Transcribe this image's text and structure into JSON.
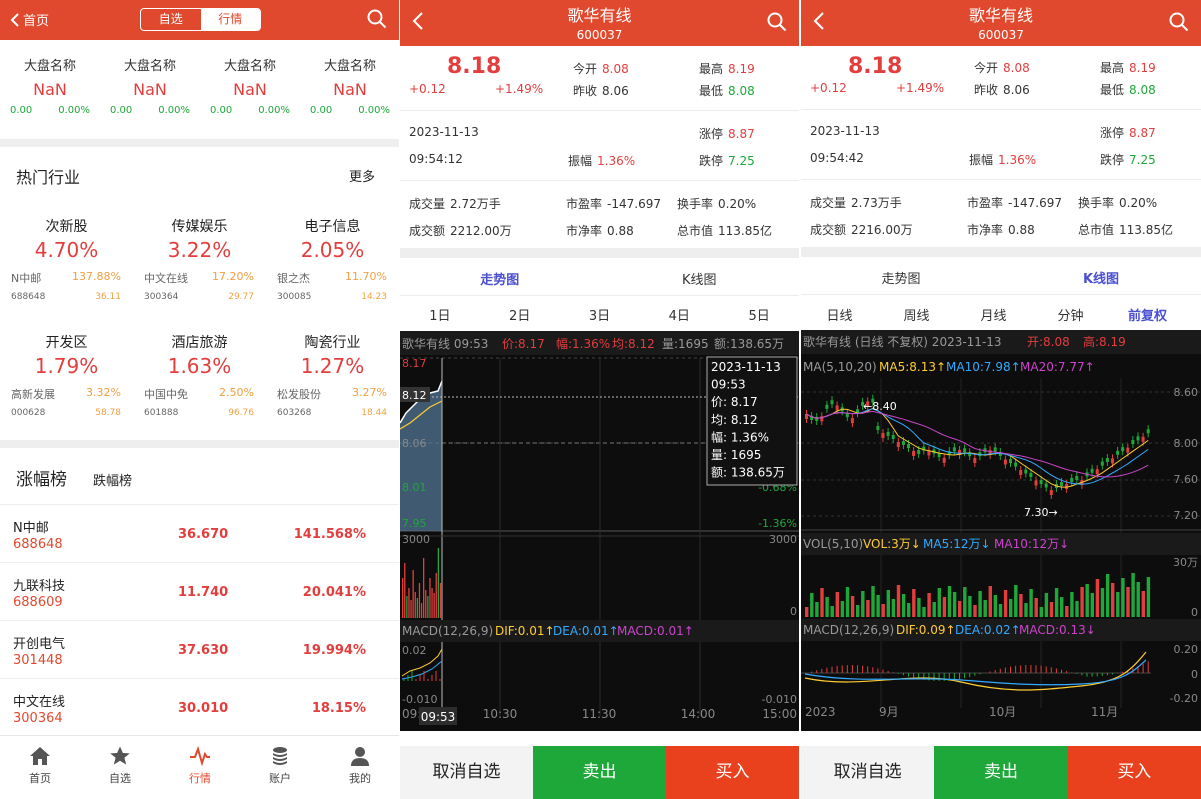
{
  "p1": {
    "header": {
      "back": "首页",
      "seg": [
        "自选",
        "行情"
      ]
    },
    "indices": [
      {
        "name": "大盘名称",
        "value": "NaN",
        "chg": "0.00",
        "pct": "0.00%"
      },
      {
        "name": "大盘名称",
        "value": "NaN",
        "chg": "0.00",
        "pct": "0.00%"
      },
      {
        "name": "大盘名称",
        "value": "NaN",
        "chg": "0.00",
        "pct": "0.00%"
      },
      {
        "name": "大盘名称",
        "value": "NaN",
        "chg": "0.00",
        "pct": "0.00%"
      }
    ],
    "hot": {
      "title": "热门行业",
      "more": "更多"
    },
    "industries": [
      {
        "name": "次新股",
        "pct": "4.70%",
        "stock": "N中邮",
        "spct": "137.88%",
        "code": "688648",
        "price": "36.11"
      },
      {
        "name": "传媒娱乐",
        "pct": "3.22%",
        "stock": "中文在线",
        "spct": "17.20%",
        "code": "300364",
        "price": "29.77"
      },
      {
        "name": "电子信息",
        "pct": "2.05%",
        "stock": "银之杰",
        "spct": "11.70%",
        "code": "300085",
        "price": "14.23"
      },
      {
        "name": "开发区",
        "pct": "1.79%",
        "stock": "高新发展",
        "spct": "3.32%",
        "code": "000628",
        "price": "58.78"
      },
      {
        "name": "酒店旅游",
        "pct": "1.63%",
        "stock": "中国中免",
        "spct": "2.50%",
        "code": "601888",
        "price": "96.76"
      },
      {
        "name": "陶瓷行业",
        "pct": "1.27%",
        "stock": "松发股份",
        "spct": "3.27%",
        "code": "603268",
        "price": "18.44"
      }
    ],
    "rank_tabs": [
      "涨幅榜",
      "跌幅榜"
    ],
    "gainers": [
      {
        "name": "N中邮",
        "code": "688648",
        "price": "36.670",
        "pct": "141.568%"
      },
      {
        "name": "九联科技",
        "code": "688609",
        "price": "11.740",
        "pct": "20.041%"
      },
      {
        "name": "开创电气",
        "code": "301448",
        "price": "37.630",
        "pct": "19.994%"
      },
      {
        "name": "中文在线",
        "code": "300364",
        "price": "30.010",
        "pct": "18.15%"
      }
    ],
    "tabbar": [
      "首页",
      "自选",
      "行情",
      "账户",
      "我的"
    ]
  },
  "p2": {
    "title": "歌华有线",
    "code": "600037",
    "price": "8.18",
    "chg": "+0.12",
    "pct": "+1.49%",
    "open_l": "今开",
    "open": "8.08",
    "prev_l": "昨收",
    "prev": "8.06",
    "high_l": "最高",
    "high": "8.19",
    "low_l": "最低",
    "low": "8.08",
    "date": "2023-11-13",
    "time": "09:54:12",
    "zt_l": "涨停",
    "zt": "8.87",
    "amp_l": "振幅",
    "amp": "1.36%",
    "dt_l": "跌停",
    "dt": "7.25",
    "vol_l": "成交量",
    "vol": "2.72万手",
    "pe_l": "市盈率",
    "pe": "-147.697",
    "tr_l": "换手率",
    "tr": "0.20%",
    "amt_l": "成交额",
    "amt": "2212.00万",
    "pb_l": "市净率",
    "pb": "0.88",
    "mv_l": "总市值",
    "mv": "113.85亿",
    "view_tabs": [
      "走势图",
      "K线图"
    ],
    "period_tabs": [
      "1日",
      "2日",
      "3日",
      "4日",
      "5日"
    ],
    "chart": {
      "info": "歌华有线 09:53",
      "price_i": "价:8.17",
      "amp_i": "幅:1.36%",
      "avg_i": "均:8.12",
      "vol_i": "量:1695",
      "amt_i": "额:138.65万",
      "y_labels": [
        "8.17",
        "8.12",
        "8.06",
        "8.01",
        "7.95"
      ],
      "pct_labels": [
        "0.76%",
        "0%",
        "-0.68%",
        "-1.36%"
      ],
      "tip": {
        "date": "2023-11-13",
        "time": "09:53",
        "price": "价: 8.17",
        "avg": "均: 8.12",
        "amp": "幅: 1.36%",
        "vol": "量: 1695",
        "amt": "额: 138.65万"
      },
      "vol_max": "3000",
      "vol_zero": "0",
      "macd_title": "MACD(12,26,9)",
      "dif": "DIF:0.01↑",
      "dea": "DEA:0.01↑",
      "macd": "MACD:0.01↑",
      "macd_hi": "0.02",
      "macd_lo": "-0.010",
      "macd_lo_r": "-0.010",
      "macd_hi_r": "0.02",
      "times": [
        "09:30",
        "10:30",
        "11:30",
        "14:00",
        "15:00"
      ],
      "cursor_time": "09:53"
    },
    "buttons": [
      "取消自选",
      "卖出",
      "买入"
    ]
  },
  "p3": {
    "title": "歌华有线",
    "code": "600037",
    "price": "8.18",
    "chg": "+0.12",
    "pct": "+1.49%",
    "open_l": "今开",
    "open": "8.08",
    "prev_l": "昨收",
    "prev": "8.06",
    "high_l": "最高",
    "high": "8.19",
    "low_l": "最低",
    "low": "8.08",
    "date": "2023-11-13",
    "time": "09:54:42",
    "zt_l": "涨停",
    "zt": "8.87",
    "amp_l": "振幅",
    "amp": "1.36%",
    "dt_l": "跌停",
    "dt": "7.25",
    "vol_l": "成交量",
    "vol": "2.73万手",
    "pe_l": "市盈率",
    "pe": "-147.697",
    "tr_l": "换手率",
    "tr": "0.20%",
    "amt_l": "成交额",
    "amt": "2216.00万",
    "pb_l": "市净率",
    "pb": "0.88",
    "mv_l": "总市值",
    "mv": "113.85亿",
    "view_tabs": [
      "走势图",
      "K线图"
    ],
    "period_tabs": [
      "日线",
      "周线",
      "月线",
      "分钟",
      "前复权"
    ],
    "chart": {
      "info": "歌华有线 (日线 不复权) 2023-11-13",
      "open_i": "开:8.08",
      "high_i": "高:8.19",
      "ma_title": "MA(5,10,20)",
      "ma5": "MA5:8.13↑",
      "ma10": "MA10:7.98↑",
      "ma20": "MA20:7.77↑",
      "y_labels": [
        "8.60",
        "8.00",
        "7.60",
        "7.20"
      ],
      "hi_mark": "←8.40",
      "lo_mark": "7.30→",
      "vol_title": "VOL(5,10)",
      "vol_i": "VOL:3万↓",
      "vma5": "MA5:12万↓",
      "vma10": "MA10:12万↓",
      "vol_max": "30万",
      "vol_zero": "0",
      "macd_title": "MACD(12,26,9)",
      "dif": "DIF:0.09↑",
      "dea": "DEA:0.02↑",
      "macd": "MACD:0.13↓",
      "macd_hi": "0.20",
      "macd_zero": "0",
      "macd_lo": "-0.20",
      "x_labels": [
        "2023",
        "9月",
        "10月",
        "11月"
      ]
    },
    "buttons": [
      "取消自选",
      "卖出",
      "买入"
    ]
  },
  "colors": {
    "brand": "#e1492e",
    "up": "#e33d3d",
    "down": "#1ea83a",
    "accent": "#4a50d0"
  }
}
